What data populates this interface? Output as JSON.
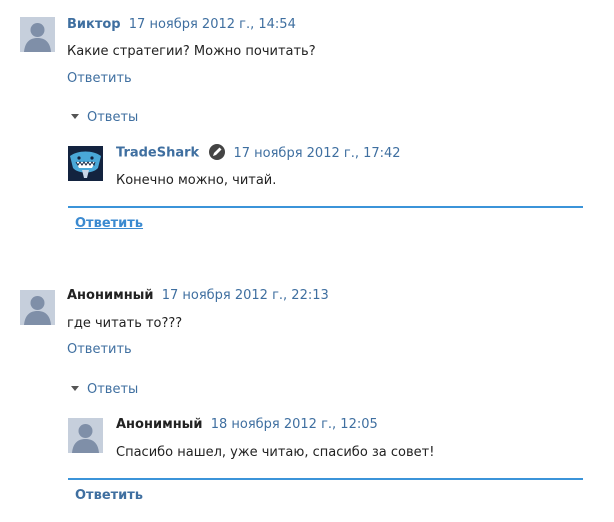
{
  "threads": [
    {
      "author": "Виктор",
      "timestamp": "17 ноября 2012 г., 14:54",
      "text": "Какие стратегии? Можно почитать?",
      "reply_label": "Ответить",
      "replies_label": "Ответы",
      "replies": [
        {
          "author": "TradeShark",
          "timestamp": "17 ноября 2012 г., 17:42",
          "text": "Конечно можно, читай."
        }
      ],
      "bottom_reply_label": "Ответить"
    },
    {
      "author": "Анонимный",
      "timestamp": "17 ноября 2012 г., 22:13",
      "text": "где читать то???",
      "reply_label": "Ответить",
      "replies_label": "Ответы",
      "replies": [
        {
          "author": "Анонимный",
          "timestamp": "18 ноября 2012 г., 12:05",
          "text": "Спасибо нашел, уже читаю, спасибо за совет!"
        }
      ],
      "bottom_reply_label": "Ответить"
    }
  ],
  "colors": {
    "link": "#3f6fa0",
    "accent_line": "#3b94d9",
    "avatar_bg": "#bfc8d6"
  },
  "icons": {
    "default_avatar": "person-silhouette-icon",
    "tradeshark_avatar": "shark-logo-icon",
    "admin_badge": "pencil-icon",
    "expand_toggle": "triangle-down-icon"
  }
}
